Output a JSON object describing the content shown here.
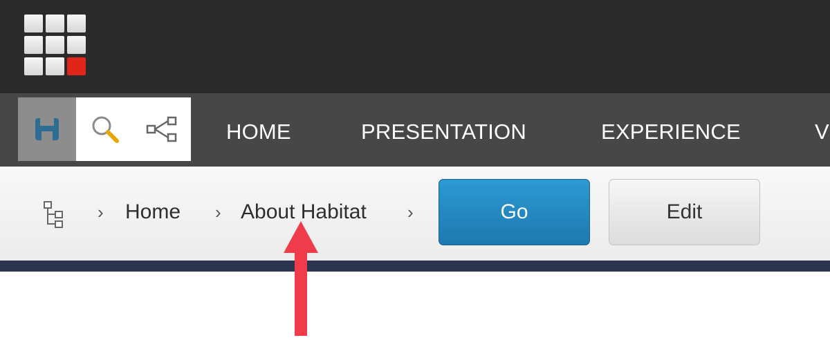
{
  "logo": {
    "icon": "sitecore-grid-logo-icon",
    "accent_color": "#e0261b"
  },
  "toolbar": {
    "quick_actions": [
      {
        "icon": "save-icon"
      },
      {
        "icon": "search-icon"
      },
      {
        "icon": "share-icon"
      }
    ],
    "menu": [
      "HOME",
      "PRESENTATION",
      "EXPERIENCE",
      "V"
    ]
  },
  "breadcrumb": {
    "tree_icon": "content-tree-icon",
    "items": [
      "Home",
      "About Habitat"
    ],
    "go_label": "Go",
    "edit_label": "Edit"
  },
  "annotation": {
    "arrow_color": "#f03c4a"
  }
}
